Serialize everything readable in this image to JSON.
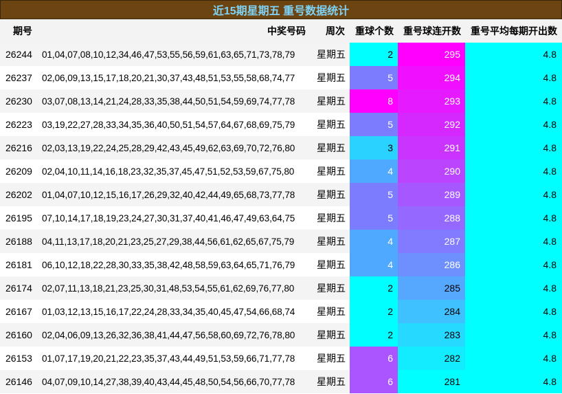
{
  "title": "近15期星期五 重号数据统计",
  "headers": {
    "qihao": "期号",
    "haoma": "中奖号码",
    "zhouci": "周次",
    "chongqiu": "重球个数",
    "lianka": "重号球连开数",
    "pingjun": "重号平均每期开出数"
  },
  "colors": {
    "cyan": "#00ffff",
    "light_cyan": "#26e0ff",
    "sky": "#2ad2ff",
    "blue": "#4fa9ff",
    "periwinkle": "#7c7cff",
    "violet": "#aa55ff",
    "purple": "#c13eff",
    "magenta": "#ff00ff",
    "pink_magenta": "#e619ff"
  },
  "rows": [
    {
      "qihao": "26244",
      "haoma": "01,04,07,08,10,12,34,46,47,53,55,56,59,61,63,65,71,73,78,79",
      "zhouci": "星期五",
      "chongqiu": "2",
      "lianka": "295",
      "pingjun": "4.8",
      "cq_color": "#00ffff",
      "lk_color": "#ff00ff"
    },
    {
      "qihao": "26237",
      "haoma": "02,06,09,13,15,17,18,20,21,30,37,43,48,51,53,55,58,68,74,77",
      "zhouci": "星期五",
      "chongqiu": "5",
      "lianka": "294",
      "pingjun": "4.8",
      "cq_color": "#7c7cff",
      "lk_color": "#f00fff"
    },
    {
      "qihao": "26230",
      "haoma": "03,07,08,13,14,21,24,28,33,35,38,44,50,51,54,59,69,74,77,78",
      "zhouci": "星期五",
      "chongqiu": "8",
      "lianka": "293",
      "pingjun": "4.8",
      "cq_color": "#ff00ff",
      "lk_color": "#e61aff"
    },
    {
      "qihao": "26223",
      "haoma": "03,19,22,27,28,33,34,35,36,40,50,51,54,57,64,67,68,69,75,79",
      "zhouci": "星期五",
      "chongqiu": "5",
      "lianka": "292",
      "pingjun": "4.8",
      "cq_color": "#7c7cff",
      "lk_color": "#d428ff"
    },
    {
      "qihao": "26216",
      "haoma": "02,03,13,19,22,24,25,28,29,42,43,45,49,62,63,69,70,72,76,80",
      "zhouci": "星期五",
      "chongqiu": "3",
      "lianka": "291",
      "pingjun": "4.8",
      "cq_color": "#2ad2ff",
      "lk_color": "#c935ff"
    },
    {
      "qihao": "26209",
      "haoma": "02,04,10,11,14,16,18,23,32,35,37,45,47,51,52,53,59,67,75,80",
      "zhouci": "星期五",
      "chongqiu": "4",
      "lianka": "290",
      "pingjun": "4.8",
      "cq_color": "#4fa9ff",
      "lk_color": "#bb45ff"
    },
    {
      "qihao": "26202",
      "haoma": "01,04,07,10,12,15,16,17,26,29,32,40,42,44,49,65,68,73,77,78",
      "zhouci": "星期五",
      "chongqiu": "5",
      "lianka": "289",
      "pingjun": "4.8",
      "cq_color": "#7c7cff",
      "lk_color": "#a757ff"
    },
    {
      "qihao": "26195",
      "haoma": "07,10,14,17,18,19,23,24,27,30,31,37,40,41,46,47,49,63,64,75",
      "zhouci": "星期五",
      "chongqiu": "5",
      "lianka": "288",
      "pingjun": "4.8",
      "cq_color": "#7c7cff",
      "lk_color": "#9568ff"
    },
    {
      "qihao": "26188",
      "haoma": "04,11,13,17,18,20,21,23,25,27,29,38,44,56,61,62,65,67,75,79",
      "zhouci": "星期五",
      "chongqiu": "4",
      "lianka": "287",
      "pingjun": "4.8",
      "cq_color": "#4fa9ff",
      "lk_color": "#837bff"
    },
    {
      "qihao": "26181",
      "haoma": "06,10,12,18,22,28,30,33,35,38,42,48,58,59,63,64,65,71,76,79",
      "zhouci": "星期五",
      "chongqiu": "4",
      "lianka": "286",
      "pingjun": "4.8",
      "cq_color": "#4fa9ff",
      "lk_color": "#6e90ff"
    },
    {
      "qihao": "26174",
      "haoma": "02,07,11,13,18,21,23,25,30,31,48,53,54,55,61,62,69,76,77,80",
      "zhouci": "星期五",
      "chongqiu": "2",
      "lianka": "285",
      "pingjun": "4.8",
      "cq_color": "#00ffff",
      "lk_color": "#56a8ff"
    },
    {
      "qihao": "26167",
      "haoma": "01,03,12,13,15,16,17,22,24,28,33,34,35,40,45,47,54,66,68,74",
      "zhouci": "星期五",
      "chongqiu": "2",
      "lianka": "284",
      "pingjun": "4.8",
      "cq_color": "#00ffff",
      "lk_color": "#3fc0ff"
    },
    {
      "qihao": "26160",
      "haoma": "02,04,06,09,13,26,32,36,38,41,44,47,56,58,60,69,72,76,78,80",
      "zhouci": "星期五",
      "chongqiu": "2",
      "lianka": "283",
      "pingjun": "4.8",
      "cq_color": "#00ffff",
      "lk_color": "#26d9ff"
    },
    {
      "qihao": "26153",
      "haoma": "01,07,17,19,20,21,22,23,35,37,43,44,49,51,53,59,66,71,77,78",
      "zhouci": "星期五",
      "chongqiu": "6",
      "lianka": "282",
      "pingjun": "4.8",
      "cq_color": "#aa55ff",
      "lk_color": "#13ecff"
    },
    {
      "qihao": "26146",
      "haoma": "04,07,09,10,14,27,38,39,40,43,44,45,48,50,54,56,66,70,77,78",
      "zhouci": "星期五",
      "chongqiu": "6",
      "lianka": "281",
      "pingjun": "4.8",
      "cq_color": "#aa55ff",
      "lk_color": "#00ffff"
    }
  ]
}
